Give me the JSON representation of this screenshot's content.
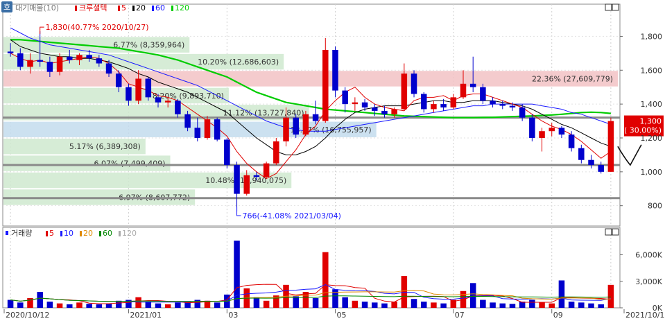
{
  "price_legend": {
    "prefix": "대기매물(10)",
    "series_label": "크루셜텍",
    "ma": [
      {
        "label": "5",
        "color": "#e00000"
      },
      {
        "label": "20",
        "color": "#000000"
      },
      {
        "label": "60",
        "color": "#1a1aff"
      },
      {
        "label": "120",
        "color": "#00cc00"
      }
    ]
  },
  "volume_legend": {
    "label": "거래량",
    "ma": [
      {
        "label": "5",
        "color": "#e00000"
      },
      {
        "label": "10",
        "color": "#1a1aff"
      },
      {
        "label": "20",
        "color": "#e08a00"
      },
      {
        "label": "60",
        "color": "#008800"
      },
      {
        "label": "120",
        "color": "#aaaaaa"
      }
    ]
  },
  "side_button": "호",
  "annotations": {
    "high": "1,830(40.77% 2020/10/27)",
    "low": "766(-41.08% 2021/03/04)"
  },
  "current_price": {
    "value": "1,300",
    "change": "( 30.00%)"
  },
  "colors": {
    "up": "#e00000",
    "down": "#0000cc",
    "supply_green": "#cfe9cf",
    "supply_red": "#f2c2c4",
    "supply_blue": "#c3dced"
  },
  "chart_data": {
    "type": "candlestick",
    "x_axis_labels": [
      "2020/10/12",
      "2021/01",
      "03",
      "05",
      "07",
      "09",
      "2021/10/13"
    ],
    "price_axis": {
      "ticks": [
        "1,800",
        "1,600",
        "1,400",
        "1,200",
        "1,000",
        "800"
      ],
      "values": [
        1800,
        1600,
        1400,
        1200,
        1000,
        800
      ],
      "range": [
        680,
        1990
      ]
    },
    "volume_axis": {
      "ticks": [
        "6,000K",
        "3,000K",
        "0K"
      ],
      "values": [
        6000,
        3000,
        0
      ],
      "range": [
        0,
        8000
      ]
    },
    "supply_zones": [
      {
        "label": "6.77% (8,359,964)",
        "price": 1750,
        "pct": 6.77
      },
      {
        "label": "10.20% (12,686,603)",
        "price": 1650,
        "pct": 10.2
      },
      {
        "label": "22.36% (27,609,779)",
        "price": 1550,
        "pct": 22.36
      },
      {
        "label": "8.20% (9,893,710)",
        "price": 1450,
        "pct": 8.2
      },
      {
        "label": "11.12% (13,727,840)",
        "price": 1350,
        "pct": 11.12
      },
      {
        "label": "13.57% (16,755,957)",
        "price": 1250,
        "pct": 13.57
      },
      {
        "label": "5.17% (6,389,308)",
        "price": 1150,
        "pct": 5.17
      },
      {
        "label": "6.07% (7,499,409)",
        "price": 1050,
        "pct": 6.07
      },
      {
        "label": "10.48% (12,940,075)",
        "price": 950,
        "pct": 10.48
      },
      {
        "label": "6.97% (8,607,772)",
        "price": 850,
        "pct": 6.97
      }
    ],
    "horizontal_lines": [
      1320,
      1040,
      845
    ],
    "ohlc": [
      {
        "o": 1710,
        "h": 1760,
        "l": 1680,
        "c": 1700
      },
      {
        "o": 1700,
        "h": 1730,
        "l": 1600,
        "c": 1620
      },
      {
        "o": 1620,
        "h": 1700,
        "l": 1580,
        "c": 1660
      },
      {
        "o": 1660,
        "h": 1830,
        "l": 1620,
        "c": 1650
      },
      {
        "o": 1650,
        "h": 1680,
        "l": 1560,
        "c": 1590
      },
      {
        "o": 1590,
        "h": 1700,
        "l": 1570,
        "c": 1680
      },
      {
        "o": 1680,
        "h": 1720,
        "l": 1640,
        "c": 1660
      },
      {
        "o": 1660,
        "h": 1700,
        "l": 1630,
        "c": 1690
      },
      {
        "o": 1690,
        "h": 1720,
        "l": 1650,
        "c": 1670
      },
      {
        "o": 1670,
        "h": 1690,
        "l": 1620,
        "c": 1640
      },
      {
        "o": 1640,
        "h": 1660,
        "l": 1560,
        "c": 1580
      },
      {
        "o": 1580,
        "h": 1600,
        "l": 1470,
        "c": 1500
      },
      {
        "o": 1500,
        "h": 1520,
        "l": 1390,
        "c": 1420
      },
      {
        "o": 1420,
        "h": 1600,
        "l": 1400,
        "c": 1550
      },
      {
        "o": 1550,
        "h": 1560,
        "l": 1420,
        "c": 1440
      },
      {
        "o": 1440,
        "h": 1460,
        "l": 1380,
        "c": 1410
      },
      {
        "o": 1410,
        "h": 1440,
        "l": 1380,
        "c": 1420
      },
      {
        "o": 1420,
        "h": 1430,
        "l": 1320,
        "c": 1340
      },
      {
        "o": 1340,
        "h": 1360,
        "l": 1240,
        "c": 1260
      },
      {
        "o": 1260,
        "h": 1320,
        "l": 1180,
        "c": 1200
      },
      {
        "o": 1200,
        "h": 1330,
        "l": 1190,
        "c": 1310
      },
      {
        "o": 1310,
        "h": 1320,
        "l": 1180,
        "c": 1190
      },
      {
        "o": 1190,
        "h": 1200,
        "l": 1020,
        "c": 1040
      },
      {
        "o": 1040,
        "h": 1060,
        "l": 766,
        "c": 870
      },
      {
        "o": 870,
        "h": 1010,
        "l": 860,
        "c": 980
      },
      {
        "o": 980,
        "h": 1000,
        "l": 950,
        "c": 970
      },
      {
        "o": 970,
        "h": 1060,
        "l": 960,
        "c": 1050
      },
      {
        "o": 1050,
        "h": 1200,
        "l": 1040,
        "c": 1180
      },
      {
        "o": 1180,
        "h": 1380,
        "l": 1150,
        "c": 1320
      },
      {
        "o": 1320,
        "h": 1340,
        "l": 1200,
        "c": 1220
      },
      {
        "o": 1220,
        "h": 1360,
        "l": 1210,
        "c": 1340
      },
      {
        "o": 1340,
        "h": 1420,
        "l": 1280,
        "c": 1300
      },
      {
        "o": 1300,
        "h": 1790,
        "l": 1290,
        "c": 1720
      },
      {
        "o": 1720,
        "h": 1740,
        "l": 1440,
        "c": 1480
      },
      {
        "o": 1480,
        "h": 1500,
        "l": 1350,
        "c": 1400
      },
      {
        "o": 1400,
        "h": 1440,
        "l": 1360,
        "c": 1410
      },
      {
        "o": 1410,
        "h": 1430,
        "l": 1360,
        "c": 1380
      },
      {
        "o": 1380,
        "h": 1400,
        "l": 1330,
        "c": 1360
      },
      {
        "o": 1360,
        "h": 1390,
        "l": 1320,
        "c": 1340
      },
      {
        "o": 1340,
        "h": 1380,
        "l": 1320,
        "c": 1370
      },
      {
        "o": 1370,
        "h": 1640,
        "l": 1360,
        "c": 1580
      },
      {
        "o": 1580,
        "h": 1600,
        "l": 1440,
        "c": 1460
      },
      {
        "o": 1460,
        "h": 1470,
        "l": 1350,
        "c": 1370
      },
      {
        "o": 1370,
        "h": 1420,
        "l": 1350,
        "c": 1400
      },
      {
        "o": 1400,
        "h": 1430,
        "l": 1360,
        "c": 1380
      },
      {
        "o": 1380,
        "h": 1460,
        "l": 1370,
        "c": 1440
      },
      {
        "o": 1440,
        "h": 1600,
        "l": 1430,
        "c": 1520
      },
      {
        "o": 1520,
        "h": 1680,
        "l": 1470,
        "c": 1500
      },
      {
        "o": 1500,
        "h": 1520,
        "l": 1400,
        "c": 1420
      },
      {
        "o": 1420,
        "h": 1440,
        "l": 1380,
        "c": 1400
      },
      {
        "o": 1400,
        "h": 1420,
        "l": 1370,
        "c": 1390
      },
      {
        "o": 1390,
        "h": 1410,
        "l": 1360,
        "c": 1380
      },
      {
        "o": 1380,
        "h": 1400,
        "l": 1300,
        "c": 1320
      },
      {
        "o": 1320,
        "h": 1340,
        "l": 1180,
        "c": 1200
      },
      {
        "o": 1200,
        "h": 1260,
        "l": 1120,
        "c": 1240
      },
      {
        "o": 1240,
        "h": 1290,
        "l": 1210,
        "c": 1260
      },
      {
        "o": 1260,
        "h": 1270,
        "l": 1200,
        "c": 1220
      },
      {
        "o": 1220,
        "h": 1240,
        "l": 1120,
        "c": 1140
      },
      {
        "o": 1140,
        "h": 1160,
        "l": 1050,
        "c": 1070
      },
      {
        "o": 1070,
        "h": 1100,
        "l": 1020,
        "c": 1040
      },
      {
        "o": 1040,
        "h": 1060,
        "l": 990,
        "c": 1000
      },
      {
        "o": 1000,
        "h": 1320,
        "l": 1000,
        "c": 1300
      }
    ],
    "ma5": [
      1700,
      1670,
      1650,
      1660,
      1640,
      1650,
      1660,
      1670,
      1680,
      1670,
      1640,
      1590,
      1520,
      1500,
      1480,
      1450,
      1440,
      1420,
      1380,
      1340,
      1300,
      1260,
      1210,
      1120,
      1050,
      1000,
      960,
      990,
      1060,
      1130,
      1220,
      1270,
      1360,
      1420,
      1470,
      1500,
      1440,
      1400,
      1380,
      1370,
      1360,
      1420,
      1440,
      1440,
      1450,
      1420,
      1450,
      1460,
      1460,
      1440,
      1420,
      1400,
      1380,
      1340,
      1300,
      1270,
      1250,
      1220,
      1180,
      1130,
      1080,
      1120
    ],
    "ma20": [
      1780,
      1740,
      1720,
      1700,
      1690,
      1680,
      1680,
      1670,
      1670,
      1660,
      1650,
      1630,
      1610,
      1580,
      1560,
      1530,
      1510,
      1490,
      1470,
      1440,
      1410,
      1380,
      1350,
      1300,
      1250,
      1200,
      1160,
      1120,
      1100,
      1100,
      1120,
      1150,
      1200,
      1260,
      1310,
      1350,
      1370,
      1380,
      1390,
      1390,
      1390,
      1400,
      1410,
      1420,
      1420,
      1410,
      1410,
      1420,
      1420,
      1420,
      1410,
      1400,
      1390,
      1370,
      1340,
      1310,
      1280,
      1260,
      1230,
      1200,
      1170,
      1150
    ],
    "ma60": [
      1850,
      1820,
      1790,
      1770,
      1750,
      1740,
      1730,
      1720,
      1710,
      1700,
      1690,
      1670,
      1650,
      1630,
      1610,
      1590,
      1570,
      1550,
      1530,
      1510,
      1480,
      1450,
      1420,
      1390,
      1360,
      1330,
      1300,
      1280,
      1260,
      1250,
      1240,
      1240,
      1240,
      1250,
      1260,
      1270,
      1280,
      1290,
      1300,
      1310,
      1320,
      1330,
      1340,
      1350,
      1360,
      1370,
      1380,
      1390,
      1390,
      1400,
      1400,
      1400,
      1400,
      1400,
      1390,
      1380,
      1370,
      1350,
      1340,
      1320,
      1300,
      1280
    ],
    "ma120": [
      1780,
      1780,
      1775,
      1770,
      1765,
      1760,
      1755,
      1750,
      1745,
      1740,
      1735,
      1730,
      1720,
      1710,
      1700,
      1690,
      1675,
      1660,
      1640,
      1620,
      1600,
      1580,
      1560,
      1530,
      1500,
      1470,
      1450,
      1430,
      1410,
      1400,
      1390,
      1380,
      1370,
      1365,
      1360,
      1355,
      1350,
      1345,
      1340,
      1335,
      1330,
      1328,
      1326,
      1324,
      1322,
      1320,
      1320,
      1320,
      1321,
      1322,
      1324,
      1326,
      1328,
      1330,
      1333,
      1336,
      1340,
      1345,
      1350,
      1352,
      1350,
      1345
    ],
    "volume": [
      900,
      600,
      1100,
      1800,
      700,
      500,
      400,
      600,
      450,
      400,
      500,
      800,
      900,
      1200,
      700,
      500,
      400,
      600,
      700,
      900,
      800,
      600,
      1500,
      7600,
      2200,
      1200,
      800,
      1400,
      2600,
      1300,
      1800,
      1100,
      6300,
      2100,
      1200,
      800,
      700,
      600,
      500,
      700,
      3600,
      1000,
      700,
      600,
      500,
      900,
      1900,
      2800,
      900,
      600,
      500,
      450,
      700,
      900,
      600,
      500,
      3100,
      700,
      600,
      500,
      400,
      2600
    ]
  }
}
